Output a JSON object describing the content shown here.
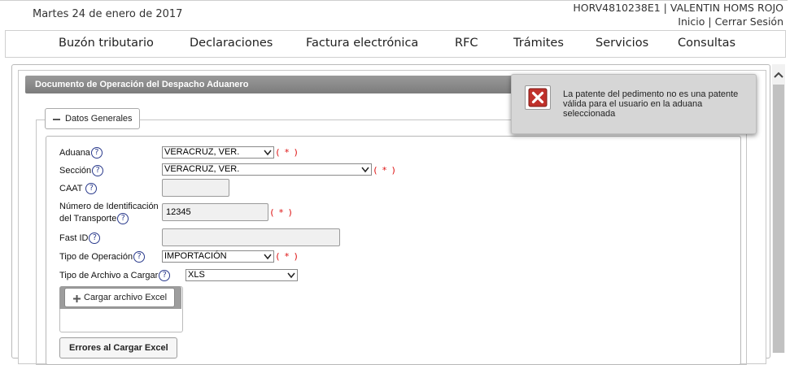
{
  "header": {
    "date": "Martes 24 de enero de 2017",
    "user_line": "HORV4810238E1 | VALENTIN HOMS ROJO",
    "inicio_link": "Inicio",
    "separator": "|",
    "logout_link": "Cerrar Sesión"
  },
  "nav": {
    "items": [
      "Buzón tributario",
      "Declaraciones",
      "Factura electrónica",
      "RFC",
      "Trámites",
      "Servicios",
      "Consultas"
    ]
  },
  "panel": {
    "title": "Documento de Operación del Despacho Aduanero"
  },
  "section": {
    "legend_label": "Datos Generales"
  },
  "form": {
    "aduana": {
      "label": "Aduana",
      "value": "VERACRUZ, VER.",
      "required": "( * )"
    },
    "seccion": {
      "label": "Sección",
      "value": "VERACRUZ, VER.",
      "required": "( * )"
    },
    "caat": {
      "label": "CAAT",
      "value": ""
    },
    "numero_transporte": {
      "label_line1": "Número de Identificación",
      "label_line2": "del Transporte",
      "value": "12345",
      "required": "( * )"
    },
    "fast_id": {
      "label": "Fast ID",
      "value": ""
    },
    "tipo_operacion": {
      "label": "Tipo de Operación",
      "value": "IMPORTACIÓN",
      "required": "( * )"
    },
    "tipo_archivo": {
      "label": "Tipo de Archivo a Cargar",
      "value": "XLS"
    },
    "help_glyph": "?"
  },
  "upload": {
    "button_label": "Cargar archivo Excel"
  },
  "errors_button": {
    "label": "Errores al Cargar Excel"
  },
  "notification": {
    "message": "La patente del pedimento no es una patente válida para el usuario en la aduana seleccionada",
    "icon": "close-x-icon",
    "icon_color": "#c0312b"
  },
  "colors": {
    "panel_header": "#8c8c8c",
    "required": "#dd1111",
    "help_icon": "#2a3a8c"
  }
}
